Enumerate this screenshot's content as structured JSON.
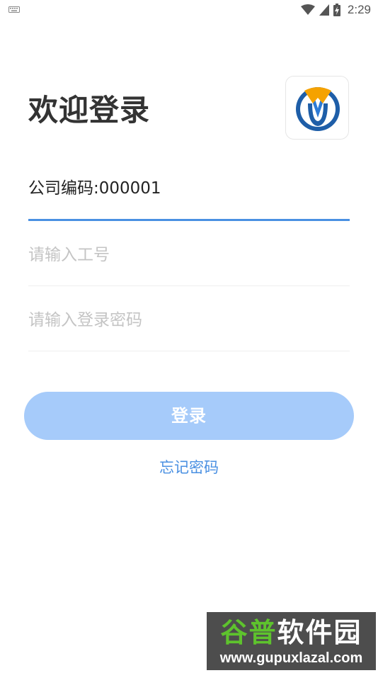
{
  "status_bar": {
    "time": "2:29",
    "icons": [
      "keyboard-icon",
      "wifi-icon",
      "signal-icon",
      "battery-charging-icon"
    ]
  },
  "header": {
    "title": "欢迎登录",
    "logo": "company-logo"
  },
  "form": {
    "company_code": "公司编码:000001",
    "employee_id_placeholder": "请输入工号",
    "employee_id_value": "",
    "password_placeholder": "请输入登录密码",
    "password_value": ""
  },
  "actions": {
    "login_label": "登录",
    "forgot_password_label": "忘记密码"
  },
  "watermark": {
    "title_part1": "谷普",
    "title_part2": "软件园",
    "url": "www.gupuxlazal.com"
  },
  "colors": {
    "accent": "#4a90e2",
    "button_disabled": "#a6cbfa",
    "logo_orange": "#f5a200",
    "logo_blue": "#1e5ea8",
    "placeholder": "#c4c4c4"
  }
}
